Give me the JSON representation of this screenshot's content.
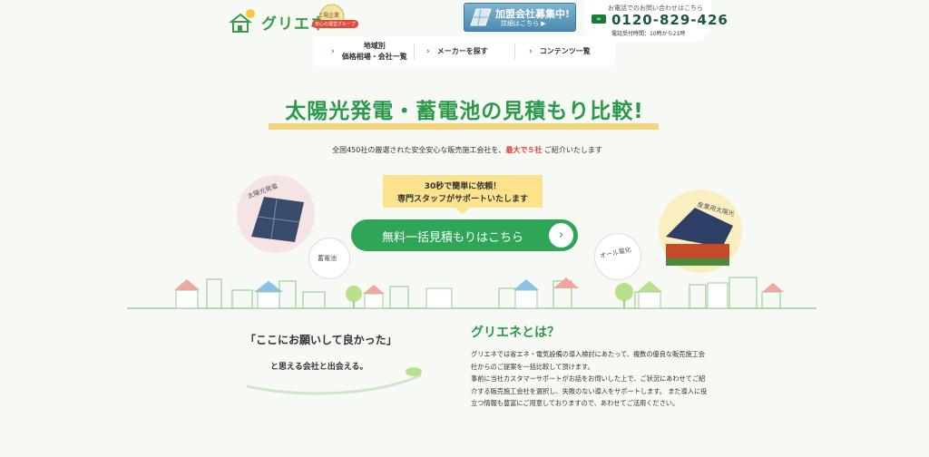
{
  "header": {
    "brand_name": "グリエネ",
    "badge_line1": "上場企業",
    "badge_line2": "安心の運営グループ",
    "recruit_line1": "加盟会社募集中!",
    "recruit_line2": "詳細はこちら ▶",
    "phone_caption": "お電話でのお問い合わせはこちら",
    "phone_number": "0120-829-426",
    "phone_hours": "電話受付時間：10時から21時",
    "freedial_icon": "freedial-icon"
  },
  "nav": {
    "items": [
      {
        "line1": "地域別",
        "line2": "価格相場・会社一覧"
      },
      {
        "line1": "メーカーを探す",
        "line2": ""
      },
      {
        "line1": "コンテンツ一覧",
        "line2": ""
      }
    ]
  },
  "hero": {
    "title": "太陽光発電・蓄電池の見積もり比較!",
    "intro_before": "全国450社の厳選された安全安心な販売施工会社を、",
    "intro_highlight": "最大で５社",
    "intro_after": " ご紹介いたします",
    "callout_line1": "30秒で簡単に依頼！",
    "callout_line2": "専門スタッフがサポートいたします",
    "cta_label": "無料一括見積もりはこちら",
    "bubble_labels": [
      "太陽光発電",
      "蓄電池",
      "オール電化",
      "産業用太陽光"
    ]
  },
  "about": {
    "quote": "「ここにお願いして良かった」",
    "quote_sub": "と思える会社と出会える。",
    "title": "グリエネとは？",
    "paragraphs": [
      "グリエネでは省エネ・電気設備の導入検討にあたって、複数の優良な販売施工会社からのご提案を一括比較して頂けます。",
      "事前に当社カスタマーサポートがお話をお伺いした上で、ご状況にあわせてご紹介する販売施工会社を選択し、失敗のない導入をサポートします。 また導入に役立つ情報も豊富にご用意しておりますので、あわせてご活用ください。"
    ]
  },
  "colors": {
    "brand_green": "#2fa558",
    "title_green": "#2a9a4a",
    "highlight_red": "#e04030",
    "callout_yellow": "#fbe38e",
    "underline_yellow": "#f2d47e"
  }
}
